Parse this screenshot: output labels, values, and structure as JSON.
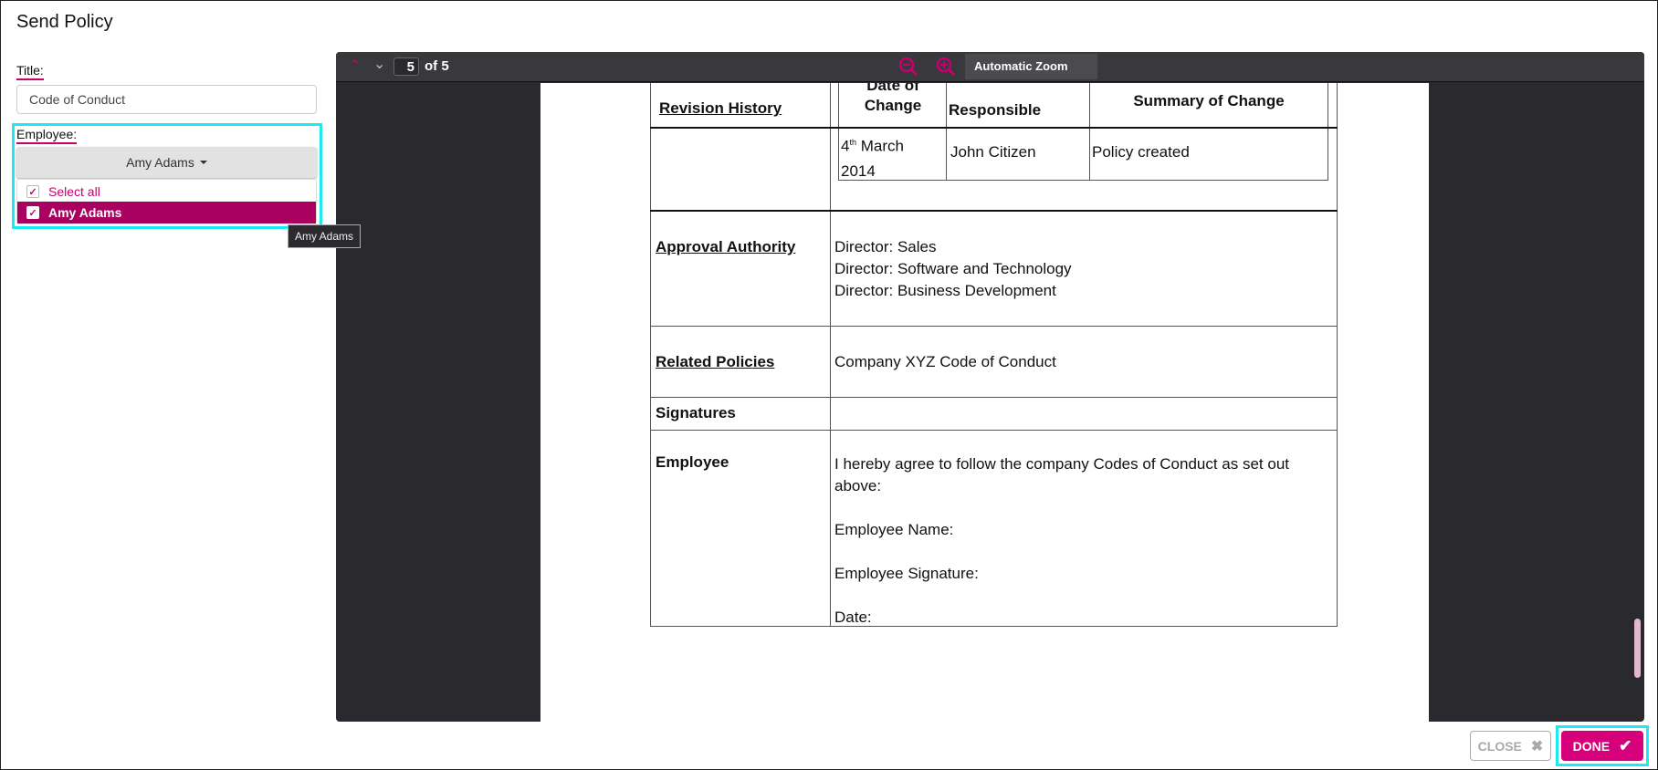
{
  "dialog": {
    "title": "Send Policy"
  },
  "form": {
    "title_label": "Title:",
    "title_value": "Code of Conduct",
    "employee_label": "Employee:",
    "employee_selected": "Amy Adams",
    "options": [
      {
        "label": "Select all",
        "checked": true
      },
      {
        "label": "Amy Adams",
        "checked": true
      }
    ],
    "tooltip": "Amy Adams"
  },
  "viewer": {
    "page": "5",
    "page_total": "of 5",
    "zoom": "Automatic Zoom"
  },
  "doc": {
    "revision_history": "Revision History",
    "headers": [
      "Date of Change",
      "Responsible",
      "Summary of Change"
    ],
    "row": {
      "date_day": "4",
      "date_sup": "th",
      "date_rest": " March",
      "date_year": "2014",
      "responsible": "John Citizen",
      "summary": "Policy created"
    },
    "approval_label": "Approval Authority",
    "approval": [
      "Director: Sales",
      "Director: Software and Technology",
      "Director: Business Development"
    ],
    "related_label": "Related Policies",
    "related": "Company XYZ Code of Conduct",
    "signatures_label": "Signatures",
    "employee_label": "Employee",
    "employee_text": "I hereby agree to follow the company Codes of Conduct as set out above:",
    "employee_name": "Employee Name:",
    "employee_signature": "Employee Signature:",
    "date": "Date:"
  },
  "footer": {
    "close": "CLOSE",
    "done": "DONE"
  },
  "colors": {
    "accent": "#c8006e",
    "highlight": "#aa005f",
    "focus": "#1de9f0"
  }
}
